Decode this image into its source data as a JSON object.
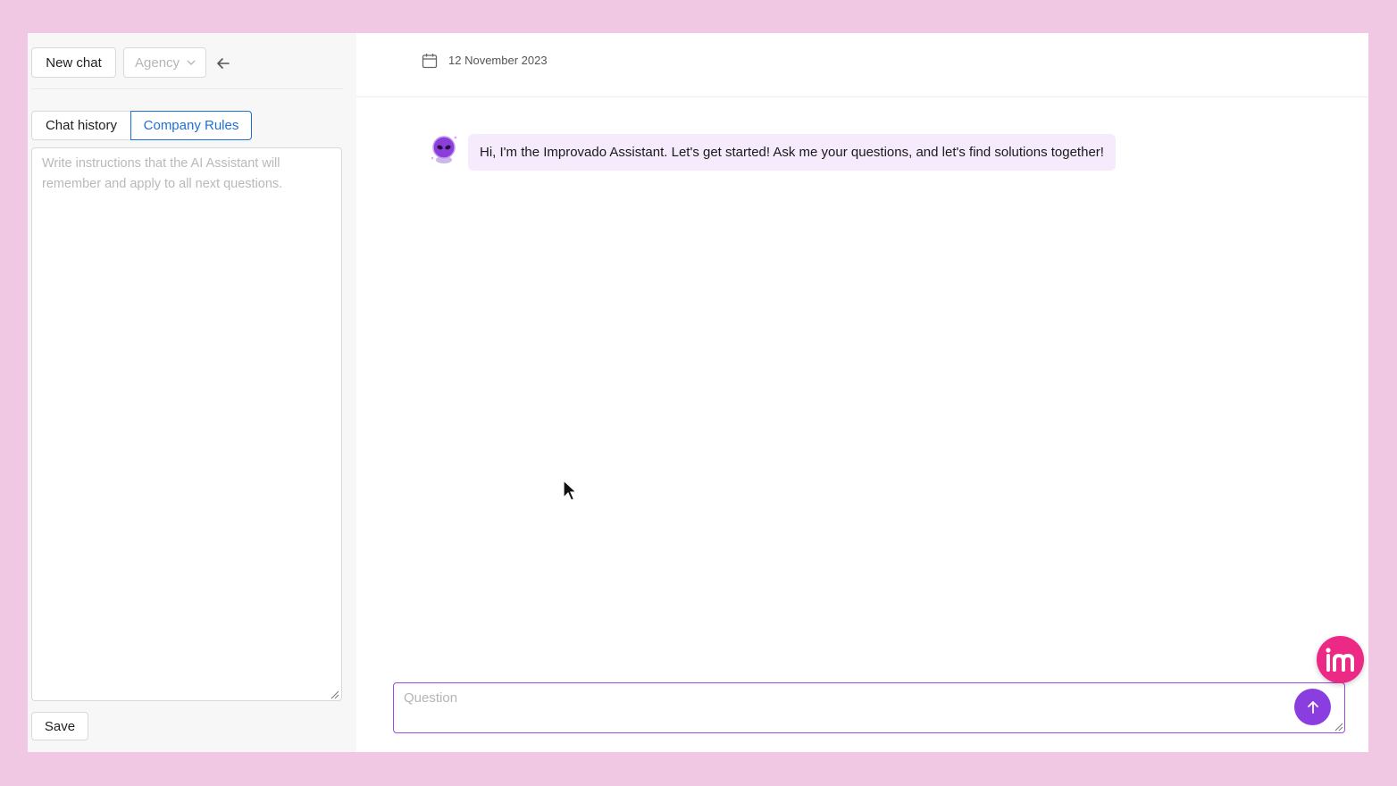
{
  "sidebar": {
    "new_chat_label": "New chat",
    "agency_select": {
      "value": "Agency"
    },
    "tabs": [
      {
        "label": "Chat history",
        "active": false
      },
      {
        "label": "Company Rules",
        "active": true
      }
    ],
    "rules_input": {
      "value": "",
      "placeholder": "Write instructions that the AI Assistant will remember and apply to all next questions."
    },
    "save_label": "Save"
  },
  "main": {
    "date": "12 November 2023",
    "messages": [
      {
        "role": "assistant",
        "text": "Hi, I'm the Improvado Assistant. Let's get started! Ask me your questions, and let's find solutions together!"
      }
    ],
    "question_input": {
      "value": "",
      "placeholder": "Question"
    }
  },
  "icons": {
    "back": "arrow-left-icon",
    "calendar": "calendar-icon",
    "send": "arrow-up-icon",
    "chevron": "chevron-down-icon",
    "logo": "improvado-logo-icon"
  },
  "colors": {
    "page_background": "#f0c8e4",
    "accent_blue": "#1f6fd6",
    "accent_purple": "#8a3ee0",
    "bubble_background": "#f5ebfc",
    "logo_pink": "#ec2a86"
  }
}
